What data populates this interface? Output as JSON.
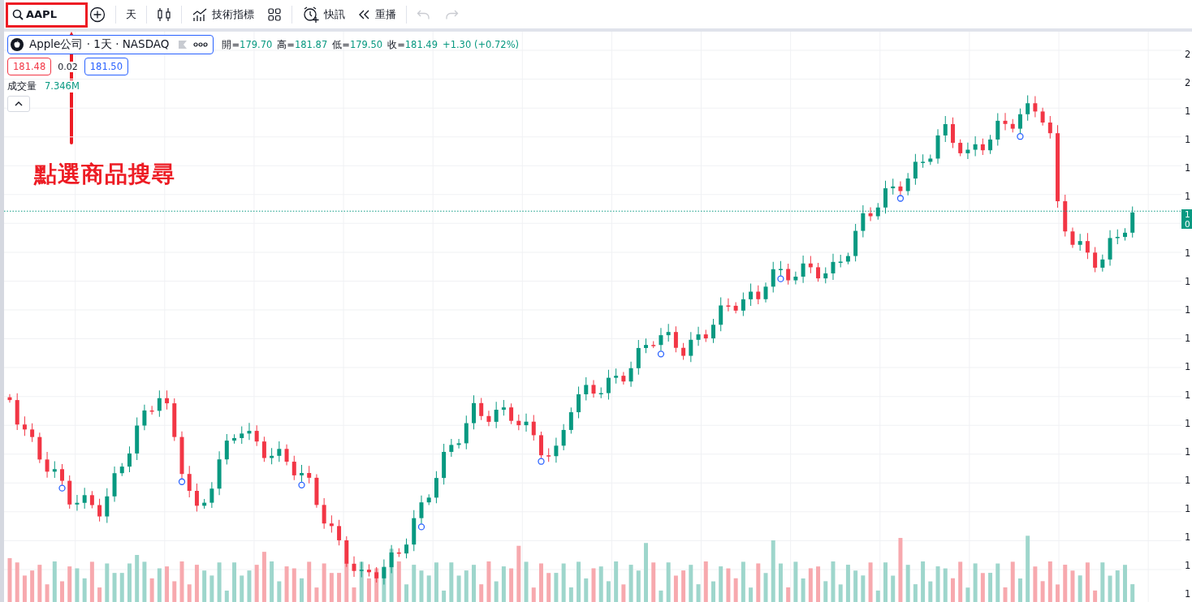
{
  "toolbar": {
    "search": {
      "value": "AAPL"
    },
    "interval": "天",
    "indicators_label": "技術指標",
    "alert_label": "快訊",
    "replay_label": "重播",
    "undo": {
      "disabled": true
    },
    "redo": {
      "disabled": true
    }
  },
  "legend": {
    "symbol": "Apple公司 · 1天 · NASDAQ",
    "ohlc": [
      {
        "label": "開=",
        "value": "179.70"
      },
      {
        "label": "高=",
        "value": "181.87"
      },
      {
        "label": "低=",
        "value": "179.50"
      },
      {
        "label": "收=",
        "value": "181.49"
      }
    ],
    "change": "+1.30 (+0.72%)",
    "bid": "181.48",
    "spread": "0.02",
    "ask": "181.50"
  },
  "volume": {
    "label": "成交量",
    "value": "7.346M"
  },
  "price_axis": {
    "labels": [
      "2",
      "2",
      "1",
      "1",
      "1",
      "1",
      "1",
      "1",
      "1",
      "1",
      "1",
      "1",
      "1",
      "1",
      "1",
      "1",
      "1",
      "1",
      "1"
    ],
    "last_price": [
      "1",
      "0"
    ]
  },
  "annotation": {
    "text": "點選商品搜尋"
  }
}
